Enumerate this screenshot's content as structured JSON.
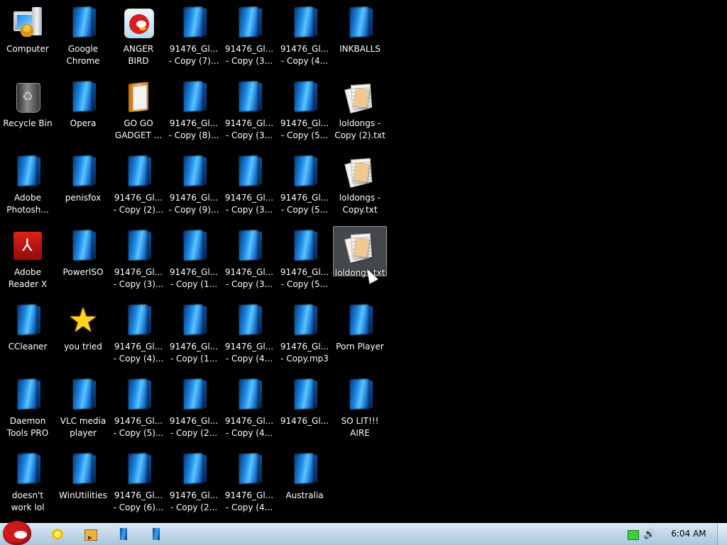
{
  "desktop": {
    "icons": [
      {
        "label": "Computer",
        "type": "computer"
      },
      {
        "label": "Recycle Bin",
        "type": "recycle"
      },
      {
        "label": "Adobe\nPhotosh...",
        "type": "blue"
      },
      {
        "label": "Adobe\nReader X",
        "type": "acrobat"
      },
      {
        "label": "CCleaner",
        "type": "blue"
      },
      {
        "label": "Daemon\nTools PRO",
        "type": "blue"
      },
      {
        "label": "doesn't\nwork lol",
        "type": "blue"
      },
      {
        "label": "Google\nChrome",
        "type": "blue"
      },
      {
        "label": "Opera",
        "type": "blue"
      },
      {
        "label": "penisfox",
        "type": "blue"
      },
      {
        "label": "PowerISO",
        "type": "blue"
      },
      {
        "label": "you tried",
        "type": "star"
      },
      {
        "label": "VLC media\nplayer",
        "type": "blue"
      },
      {
        "label": "WinUtilities",
        "type": "blue"
      },
      {
        "label": "ANGER\nBIRD",
        "type": "bird"
      },
      {
        "label": "GO GO\nGADGET ...",
        "type": "folder"
      },
      {
        "label": "91476_Gl...\n- Copy (2)...",
        "type": "blue"
      },
      {
        "label": "91476_Gl...\n- Copy (3)...",
        "type": "blue"
      },
      {
        "label": "91476_Gl...\n- Copy (4)...",
        "type": "blue"
      },
      {
        "label": "91476_Gl...\n- Copy (5)...",
        "type": "blue"
      },
      {
        "label": "91476_Gl...\n- Copy (6)...",
        "type": "blue"
      },
      {
        "label": "91476_Gl...\n- Copy (7)...",
        "type": "blue"
      },
      {
        "label": "91476_Gl...\n- Copy (8)...",
        "type": "blue"
      },
      {
        "label": "91476_Gl...\n- Copy (9)...",
        "type": "blue"
      },
      {
        "label": "91476_Gl...\n- Copy (1...",
        "type": "blue"
      },
      {
        "label": "91476_Gl...\n- Copy (1...",
        "type": "blue"
      },
      {
        "label": "91476_Gl...\n- Copy (2...",
        "type": "blue"
      },
      {
        "label": "91476_Gl...\n- Copy (2...",
        "type": "blue"
      },
      {
        "label": "91476_Gl...\n- Copy (3...",
        "type": "blue"
      },
      {
        "label": "91476_Gl...\n- Copy (3...",
        "type": "blue"
      },
      {
        "label": "91476_Gl...\n- Copy (3...",
        "type": "blue"
      },
      {
        "label": "91476_Gl...\n- Copy (3...",
        "type": "blue"
      },
      {
        "label": "91476_Gl...\n- Copy (4...",
        "type": "blue"
      },
      {
        "label": "91476_Gl...\n- Copy (4...",
        "type": "blue"
      },
      {
        "label": "91476_Gl...\n- Copy (4...",
        "type": "blue"
      },
      {
        "label": "91476_Gl...\n- Copy (4...",
        "type": "blue"
      },
      {
        "label": "91476_Gl...\n- Copy (5...",
        "type": "blue"
      },
      {
        "label": "91476_Gl...\n- Copy (5...",
        "type": "blue"
      },
      {
        "label": "91476_Gl...\n- Copy (5...",
        "type": "blue"
      },
      {
        "label": "91476_Gl...\n- Copy.mp3",
        "type": "blue"
      },
      {
        "label": "91476_Gl...",
        "type": "blue"
      },
      {
        "label": "Australia",
        "type": "blue"
      },
      {
        "label": "INKBALLS",
        "type": "blue"
      },
      {
        "label": "loldongs -\nCopy (2).txt",
        "type": "txt"
      },
      {
        "label": "loldongs -\nCopy.txt",
        "type": "txt"
      },
      {
        "label": "loldongs.txt",
        "type": "txt",
        "selected": true
      },
      {
        "label": "Porn Player",
        "type": "blue"
      },
      {
        "label": "SO LIT!!!\nAIRE",
        "type": "blue"
      }
    ]
  },
  "taskbar": {
    "start": {
      "icon": "angry-bird-start-orb"
    },
    "pinned": [
      {
        "name": "sun-gadget-icon"
      },
      {
        "name": "media-player-icon"
      },
      {
        "name": "blue-app-icon"
      },
      {
        "name": "blue-app-icon-2"
      }
    ],
    "tray": {
      "network_icon": "network-icon",
      "volume_icon": "volume-icon",
      "clock": "6:04 AM"
    }
  }
}
